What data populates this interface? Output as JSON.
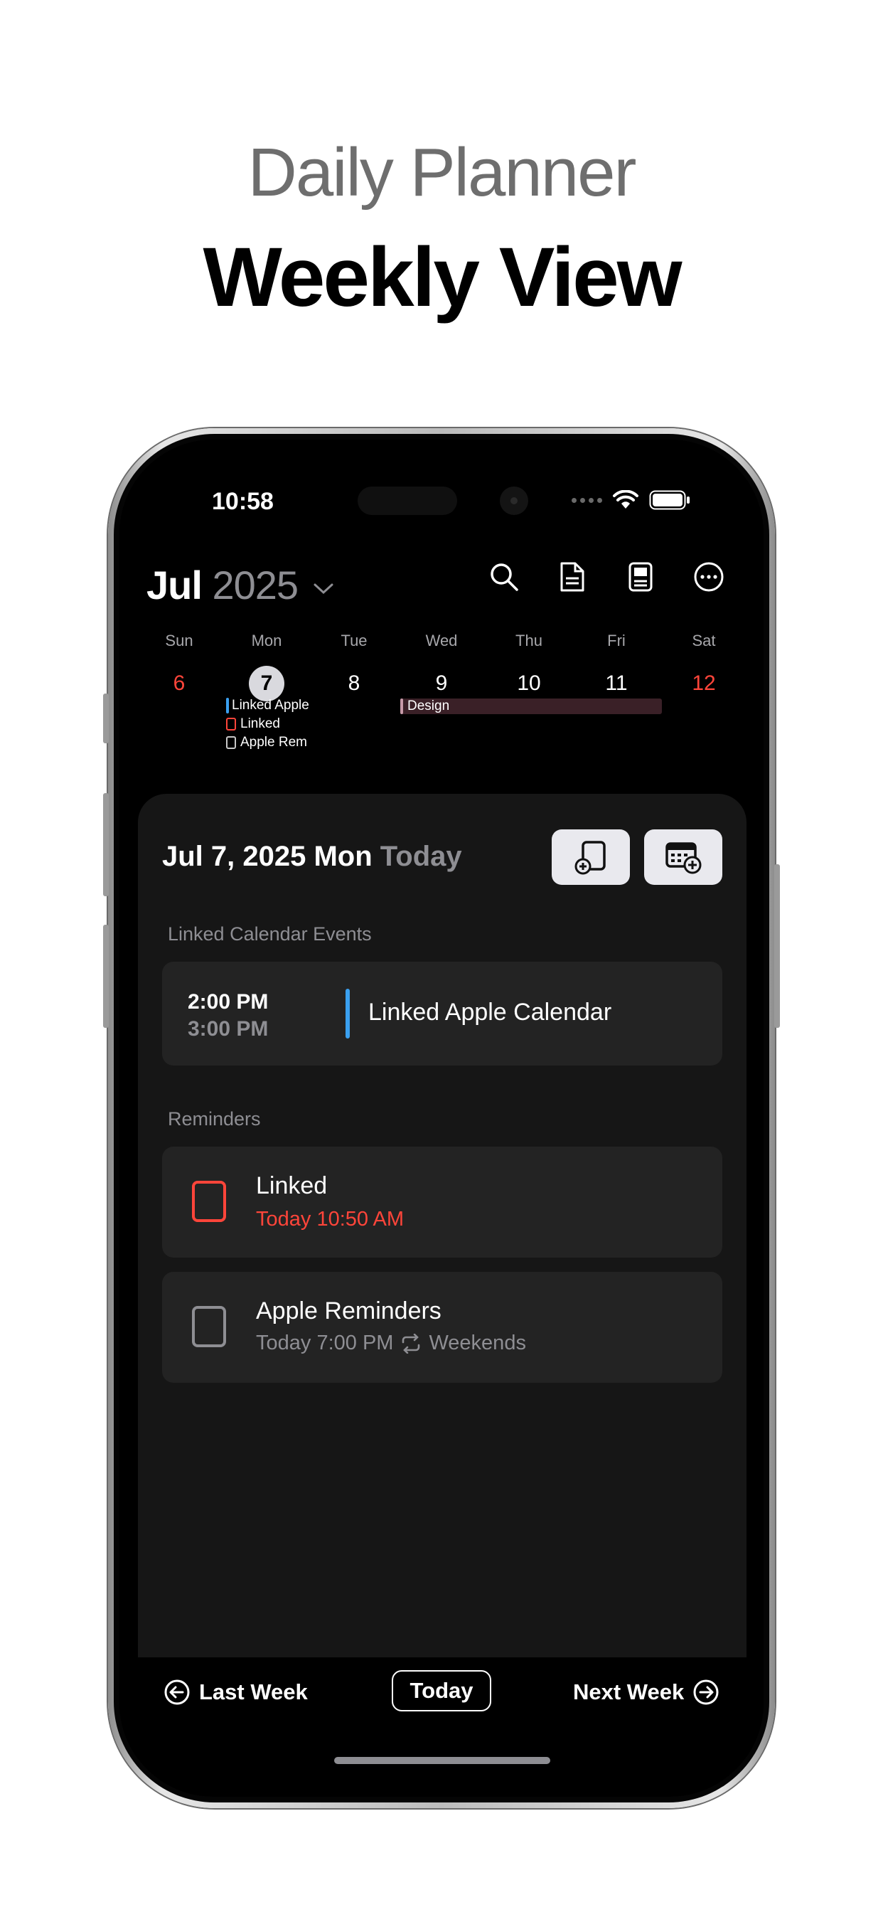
{
  "promo": {
    "subtitle": "Daily Planner",
    "title": "Weekly View"
  },
  "status": {
    "time": "10:58"
  },
  "header": {
    "month": "Jul",
    "year": "2025"
  },
  "header_icons": [
    "search-icon",
    "note-icon",
    "calendar-page-icon",
    "more-icon"
  ],
  "week": {
    "days": [
      {
        "name": "Sun",
        "num": "6"
      },
      {
        "name": "Mon",
        "num": "7"
      },
      {
        "name": "Tue",
        "num": "8"
      },
      {
        "name": "Wed",
        "num": "9"
      },
      {
        "name": "Thu",
        "num": "10"
      },
      {
        "name": "Fri",
        "num": "11"
      },
      {
        "name": "Sat",
        "num": "12"
      }
    ],
    "mon_items": [
      "Linked Apple",
      "Linked",
      "Apple Rem"
    ],
    "design_event": "Design"
  },
  "panel": {
    "date": "Jul 7, 2025 Mon",
    "today_label": "Today",
    "events_section": "Linked Calendar Events",
    "event": {
      "start": "2:00 PM",
      "end": "3:00 PM",
      "title": "Linked Apple Calendar"
    },
    "reminders_section": "Reminders",
    "reminders": [
      {
        "title": "Linked",
        "sub": "Today 10:50 AM"
      },
      {
        "title": "Apple Reminders",
        "sub": "Today 7:00 PM",
        "repeat": "Weekends"
      }
    ]
  },
  "nav": {
    "last_week": "Last Week",
    "today": "Today",
    "next_week": "Next Week"
  },
  "colors": {
    "accent_blue": "#3aa0f0",
    "alert_red": "#ff453a",
    "panel_bg": "#161616"
  }
}
